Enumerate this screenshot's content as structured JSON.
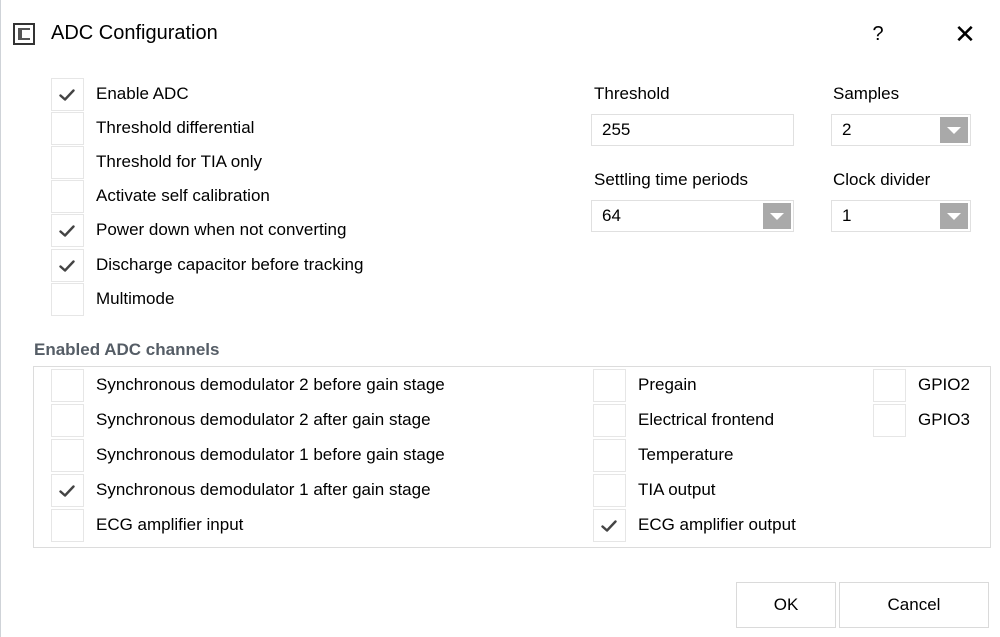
{
  "window": {
    "title": "ADC Configuration",
    "help_label": "?",
    "close_label": "✕"
  },
  "options": [
    {
      "label": "Enable ADC",
      "checked": true
    },
    {
      "label": "Threshold differential",
      "checked": false
    },
    {
      "label": "Threshold for TIA only",
      "checked": false
    },
    {
      "label": "Activate self calibration",
      "checked": false
    },
    {
      "label": "Power down when not converting",
      "checked": true
    },
    {
      "label": "Discharge capacitor before tracking",
      "checked": true
    },
    {
      "label": "Multimode",
      "checked": false
    }
  ],
  "settings": {
    "threshold_label": "Threshold",
    "threshold_value": "255",
    "samples_label": "Samples",
    "samples_value": "2",
    "settling_label": "Settling time periods",
    "settling_value": "64",
    "clock_label": "Clock divider",
    "clock_value": "1"
  },
  "channels": {
    "title": "Enabled ADC channels",
    "col1": [
      {
        "label": "Synchronous demodulator 2 before gain stage",
        "checked": false
      },
      {
        "label": "Synchronous demodulator 2 after gain stage",
        "checked": false
      },
      {
        "label": "Synchronous demodulator 1 before gain stage",
        "checked": false
      },
      {
        "label": "Synchronous demodulator 1 after gain stage",
        "checked": true
      },
      {
        "label": "ECG amplifier input",
        "checked": false
      }
    ],
    "col2": [
      {
        "label": "Pregain",
        "checked": false
      },
      {
        "label": "Electrical frontend",
        "checked": false
      },
      {
        "label": "Temperature",
        "checked": false
      },
      {
        "label": "TIA output",
        "checked": false
      },
      {
        "label": "ECG amplifier output",
        "checked": true
      }
    ],
    "col3": [
      {
        "label": "GPIO2",
        "checked": false
      },
      {
        "label": "GPIO3",
        "checked": false
      }
    ]
  },
  "buttons": {
    "ok_label": "OK",
    "cancel_label": "Cancel"
  }
}
